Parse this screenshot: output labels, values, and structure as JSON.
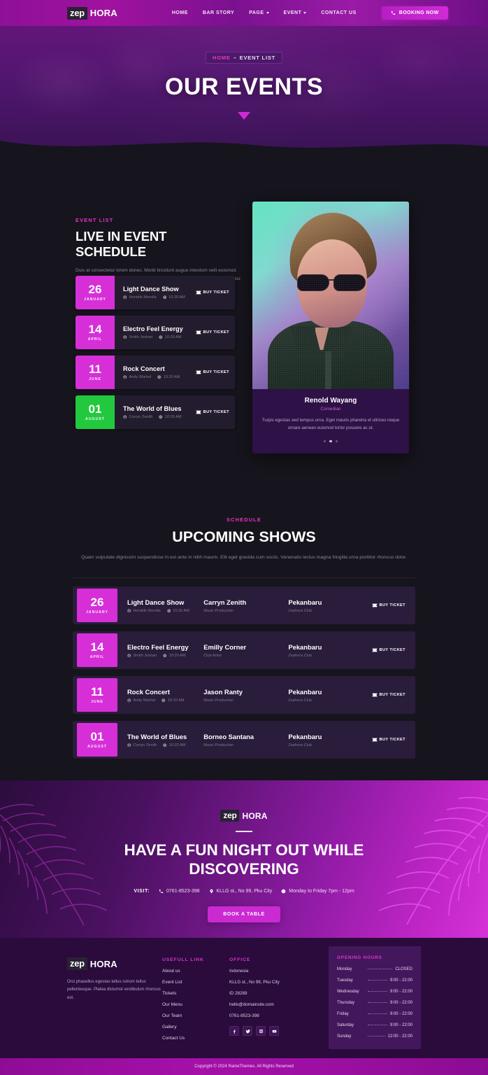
{
  "header": {
    "logo": {
      "mark": "zep",
      "name": "HORA"
    },
    "nav": [
      {
        "label": "HOME",
        "caret": false
      },
      {
        "label": "BAR STORY",
        "caret": false
      },
      {
        "label": "PAGE",
        "caret": true
      },
      {
        "label": "EVENT",
        "caret": true
      },
      {
        "label": "CONTACT US",
        "caret": false
      }
    ],
    "booking_label": "BOOKING NOW"
  },
  "hero": {
    "breadcrumb_home": "HOME",
    "breadcrumb_sep": "–",
    "breadcrumb_current": "EVENT LIST",
    "title": "OUR EVENTS"
  },
  "events_section": {
    "eyebrow": "EVENT LIST",
    "title": "LIVE IN EVENT SCHEDULE",
    "description": "Duis at consectetur lorem donec. Morbi tincidunt augue interdum velit euismod. Dolor morbi non arcu risus quis varius quam quisque id. Convallis convallis tellus id interdum. Velit scelerisque in dictum.",
    "buy_label": "BUY TICKET",
    "cards": [
      {
        "day": "26",
        "month": "JANUARY",
        "name": "Light Dance Show",
        "host": "Hendrik Morella",
        "time": "10:20 AM",
        "accent": "#d62fd8"
      },
      {
        "day": "14",
        "month": "APRIL",
        "name": "Electro Feel Energy",
        "host": "Smith Joshan",
        "time": "10:20 AM",
        "accent": "#d62fd8"
      },
      {
        "day": "11",
        "month": "JUNE",
        "name": "Rock Concert",
        "host": "Andy Warhol",
        "time": "10:20 AM",
        "accent": "#d62fd8"
      },
      {
        "day": "01",
        "month": "AUGUST",
        "name": "The World of Blues",
        "host": "Carryn Zenith",
        "time": "10:20 AM",
        "accent": "#22c93f"
      }
    ]
  },
  "artist_card": {
    "name": "Renold Wayang",
    "role": "Comedian",
    "description": "Turpis egestas sed tempus urna. Eget mauris pharetra et ultrices neque ornare aenean euismod tortor posuere ac ut.",
    "dots": 3,
    "active_dot": 1
  },
  "upcoming": {
    "eyebrow": "SCHEDULE",
    "title": "UPCOMING SHOWS",
    "description": "Quam vulputate dignissim suspendisse in est ante in nibh mauris. Elit eget gravida cum sociis. Venenatis lectus magna fringilla urna porttitor rhoncus dolor.",
    "buy_label": "BUY TICKET",
    "rows": [
      {
        "day": "26",
        "month": "JANUARY",
        "name": "Light Dance Show",
        "host": "Hendrik Morella",
        "time": "10:20 AM",
        "person": "Carryn Zenith",
        "person_role": "Music Production",
        "place": "Pekanbaru",
        "venue": "Zephora Club"
      },
      {
        "day": "14",
        "month": "APRIL",
        "name": "Electro Feel Energy",
        "host": "Smith Joshan",
        "time": "10:20 AM",
        "person": "Emilly Corner",
        "person_role": "Club Artist",
        "place": "Pekanbaru",
        "venue": "Zephora Club"
      },
      {
        "day": "11",
        "month": "JUNE",
        "name": "Rock Concert",
        "host": "Andy Warhol",
        "time": "10:20 AM",
        "person": "Jason Ranty",
        "person_role": "Music Production",
        "place": "Pekanbaru",
        "venue": "Zephora Club"
      },
      {
        "day": "01",
        "month": "AUGUST",
        "name": "The World of Blues",
        "host": "Carryn Zenith",
        "time": "10:20 AM",
        "person": "Borneo Santana",
        "person_role": "Music Production",
        "place": "Pekanbaru",
        "venue": "Zephora Club"
      }
    ]
  },
  "cta": {
    "logo": {
      "mark": "zep",
      "name": "HORA"
    },
    "title_line1": "HAVE A FUN NIGHT OUT WHILE",
    "title_line2": "DISCOVERING",
    "visit_label": "VISIT:",
    "phone": "0761-8523-398",
    "address": "KLLG st., No 99, Pku City",
    "hours": "Monday to Friday 7pm - 12pm",
    "button_label": "BOOK A TABLE"
  },
  "footer": {
    "logo": {
      "mark": "zep",
      "name": "HORA"
    },
    "description": "Orci phasellus egestas tellus rutrum tellus pellentesque. Platea dictumst vestibulum rhoncus est.",
    "links_head": "USEFULL LINK",
    "links": [
      "About us",
      "Event List",
      "Tickets",
      "Our Menu",
      "Our Team",
      "Gallery",
      "Contact Us"
    ],
    "office_head": "OFFICE",
    "office_lines": [
      "Indonesia",
      "KLLG st., No 99, Pku City",
      "ID 28289",
      "hello@domainsite.com",
      "0761-8523-398"
    ],
    "socials": [
      "facebook-icon",
      "twitter-icon",
      "instagram-icon",
      "youtube-icon"
    ],
    "hours_head": "OPENING HOURS",
    "hours": [
      {
        "day": "Monday",
        "value": "CLOSED"
      },
      {
        "day": "Tuesday",
        "value": "9:00 - 22:00"
      },
      {
        "day": "Wednesday",
        "value": "9:00 - 22:00"
      },
      {
        "day": "Thursday",
        "value": "9:00 - 22:00"
      },
      {
        "day": "Friday",
        "value": "9:00 - 22:00"
      },
      {
        "day": "Saturday",
        "value": "9:00 - 22:00"
      },
      {
        "day": "Sunday",
        "value": "12:00 - 22:00"
      }
    ]
  },
  "copyright": {
    "text": "Copyright © 2024 RameThemes. All Rights Reserved"
  },
  "colors": {
    "accent": "#d62fd8",
    "pink": "#e335c4",
    "green": "#22c93f",
    "bg": "#16141c",
    "footer_bg": "#2a0b3c"
  }
}
